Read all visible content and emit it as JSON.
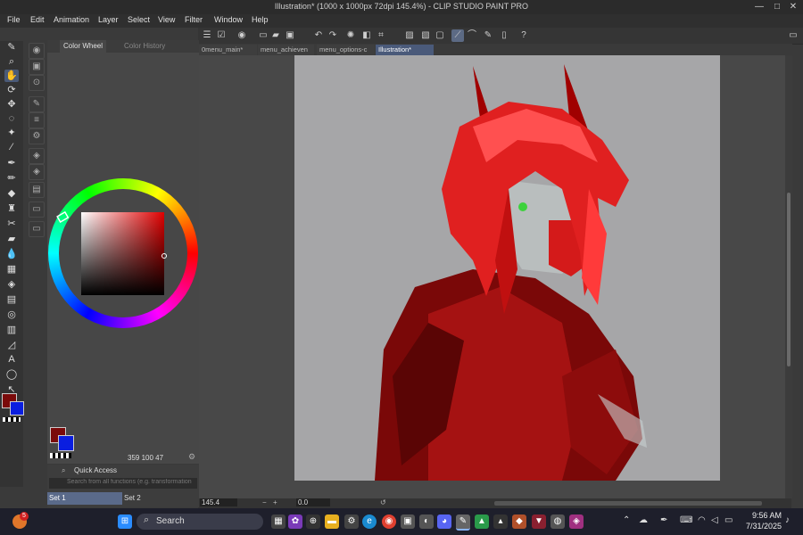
{
  "window": {
    "title": "Illustration* (1000 x 1000px 72dpi 145.4%) - CLIP STUDIO PAINT PRO",
    "min": "—",
    "max": "□",
    "close": "✕"
  },
  "menu": [
    "File",
    "Edit",
    "Animation",
    "Layer",
    "Select",
    "View",
    "Filter",
    "Window",
    "Help"
  ],
  "color_panel": {
    "tab_active": "Color Wheel",
    "tab_inactive": "Color History",
    "hsv": "359 100 47",
    "accent_main": "#7a0a0a",
    "accent_sub": "#0a1ee0"
  },
  "doc_tabs": [
    "0menu_main*",
    "menu_achieven",
    "menu_options-c",
    "Illustration*"
  ],
  "status": {
    "zoom": "145.4",
    "angle": "0.0"
  },
  "quick_access": {
    "title": "Quick Access",
    "search_placeholder": "Search from all functions (e.g. transformation, ol b",
    "sets": [
      "Set 1",
      "Set 2"
    ]
  },
  "taskbar": {
    "search_label": "Search",
    "time": "9:56 AM",
    "date": "7/31/2025",
    "notif_count": "5"
  }
}
